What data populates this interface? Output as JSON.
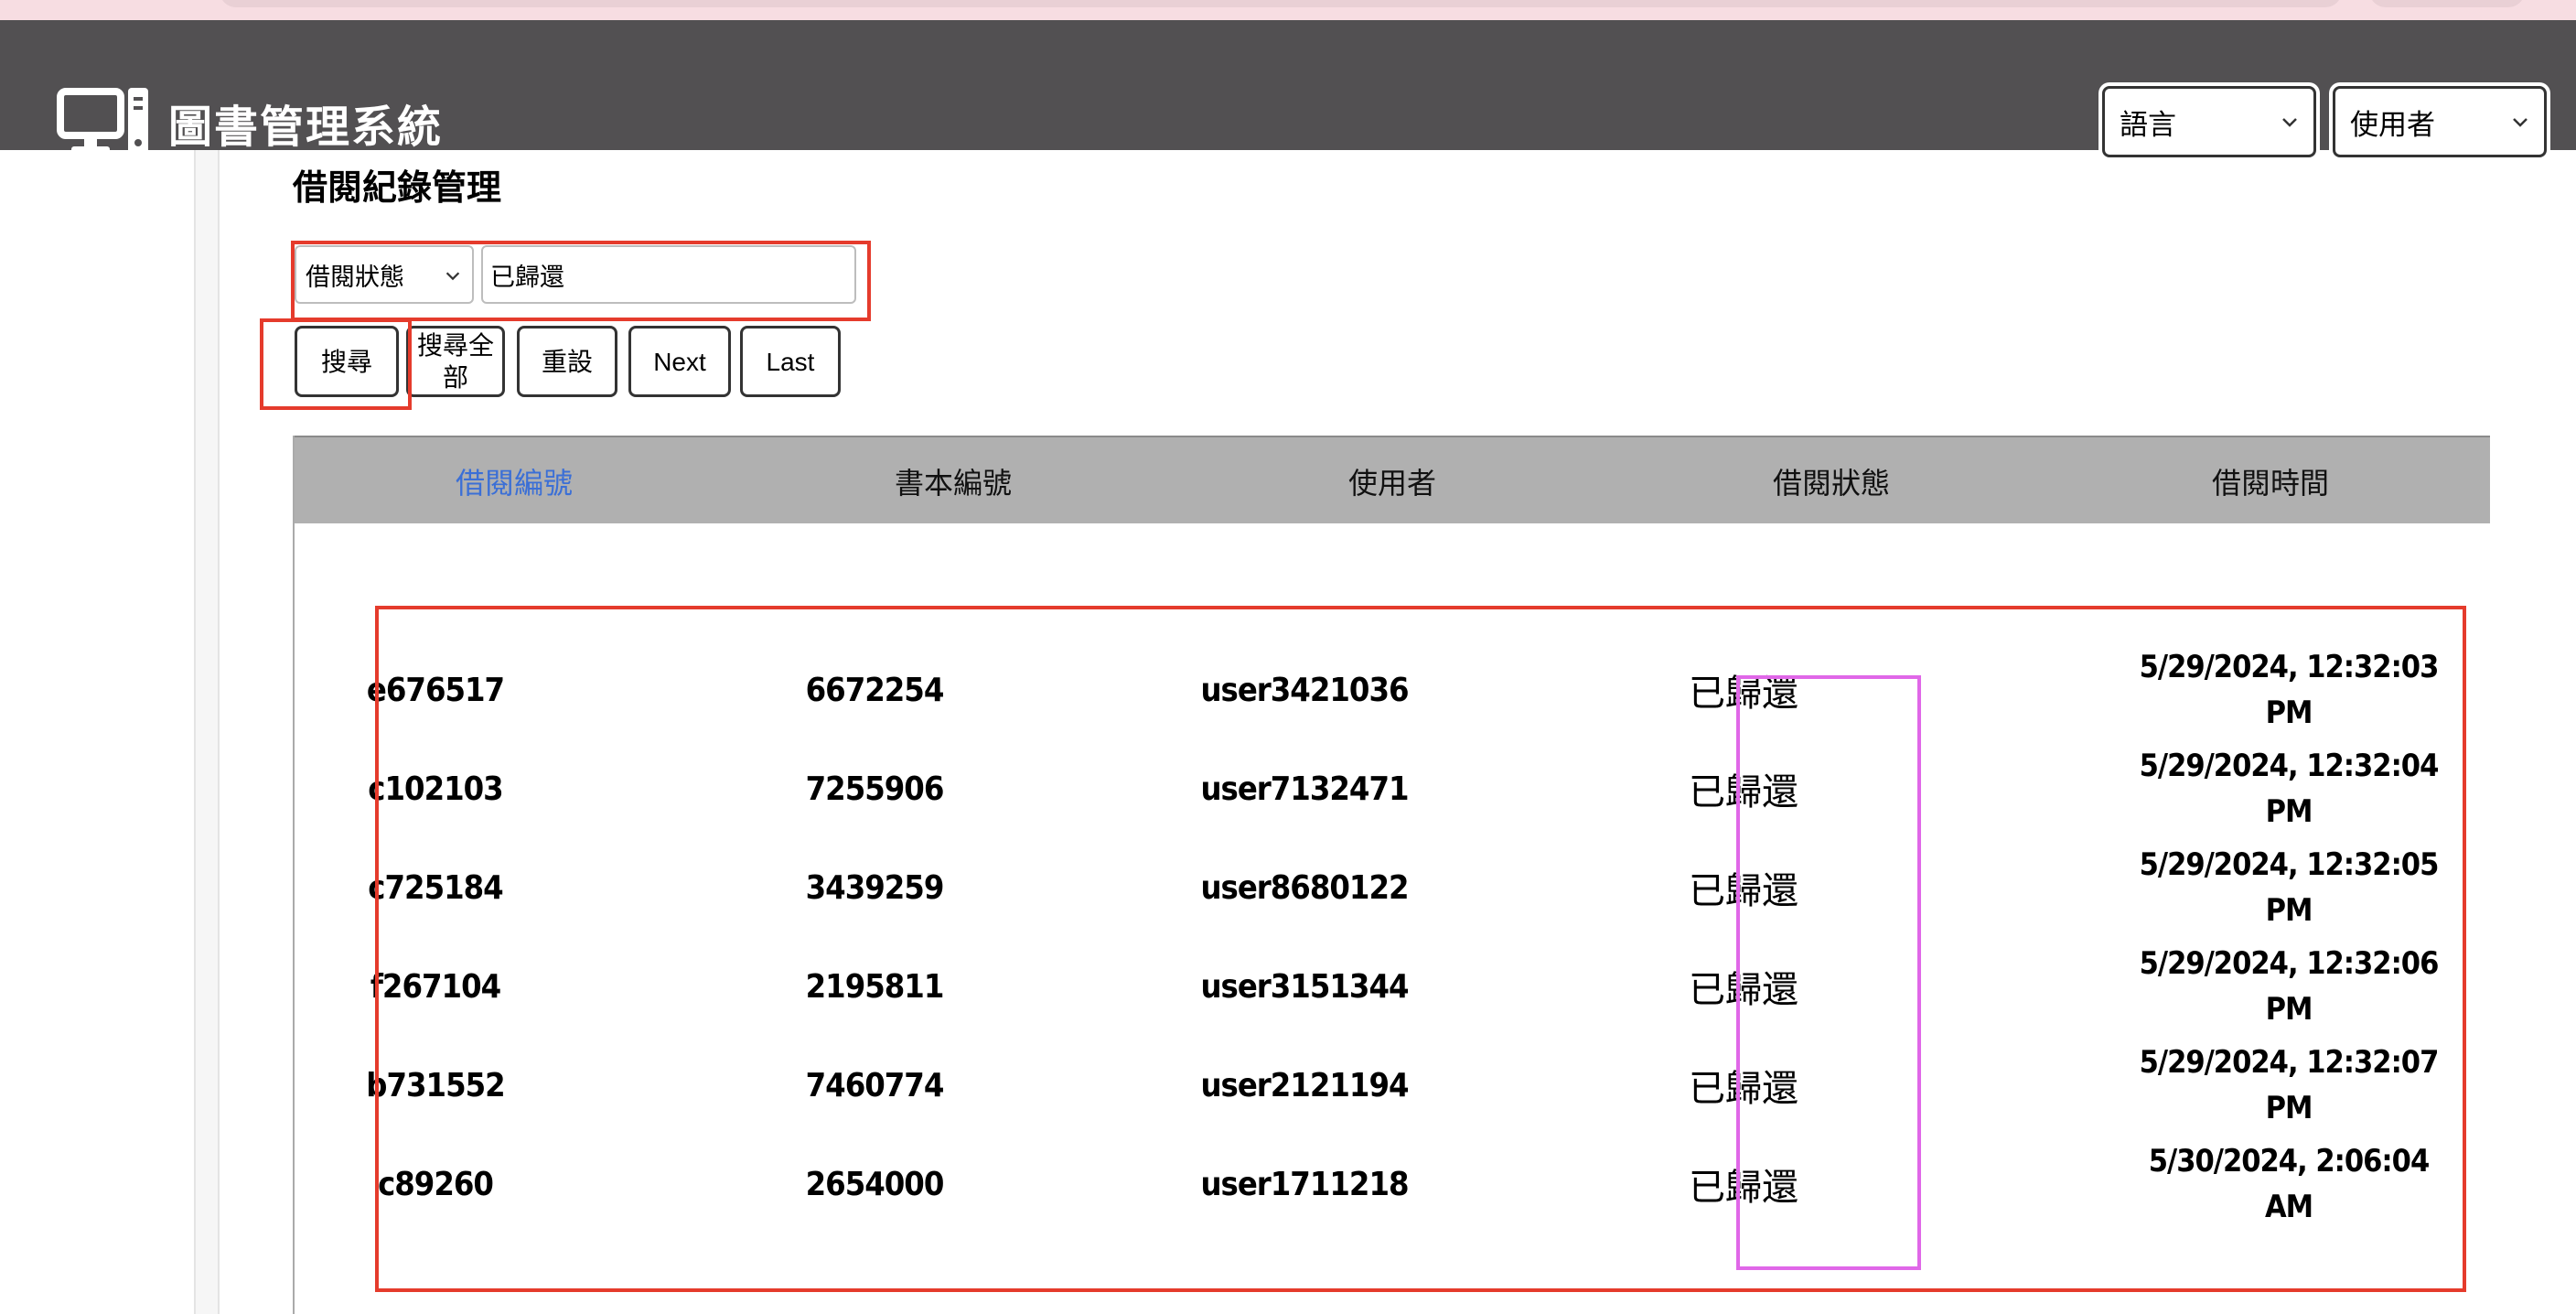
{
  "header": {
    "app_title": "圖書管理系統",
    "brand_icon": "computer-icon",
    "language_select": "語言",
    "user_select": "使用者"
  },
  "page": {
    "title": "借閱紀錄管理"
  },
  "filter": {
    "field_select": "借閱狀態",
    "value": "已歸還"
  },
  "buttons": {
    "search": "搜尋",
    "search_all": "搜尋全部",
    "reset": "重設",
    "next": "Next",
    "last": "Last"
  },
  "table": {
    "columns": [
      "借閱編號",
      "書本編號",
      "使用者",
      "借閱狀態",
      "借閱時間"
    ],
    "rows": [
      {
        "borrow_id": "e676517",
        "book_id": "6672254",
        "user": "user3421036",
        "status": "已歸還",
        "time": "5/29/2024, 12:32:03 PM"
      },
      {
        "borrow_id": "c102103",
        "book_id": "7255906",
        "user": "user7132471",
        "status": "已歸還",
        "time": "5/29/2024, 12:32:04 PM"
      },
      {
        "borrow_id": "c725184",
        "book_id": "3439259",
        "user": "user8680122",
        "status": "已歸還",
        "time": "5/29/2024, 12:32:05 PM"
      },
      {
        "borrow_id": "f267104",
        "book_id": "2195811",
        "user": "user3151344",
        "status": "已歸還",
        "time": "5/29/2024, 12:32:06 PM"
      },
      {
        "borrow_id": "b731552",
        "book_id": "7460774",
        "user": "user2121194",
        "status": "已歸還",
        "time": "5/29/2024, 12:32:07 PM"
      },
      {
        "borrow_id": "c89260",
        "book_id": "2654000",
        "user": "user1711218",
        "status": "已歸還",
        "time": "5/30/2024, 2:06:04 AM"
      }
    ]
  },
  "colors": {
    "header_bg": "#525052",
    "table_header_bg": "#b0b0b0",
    "active_column": "#3b6fd6",
    "annotation_red": "#e53b2c",
    "annotation_pink": "#e067e8"
  }
}
